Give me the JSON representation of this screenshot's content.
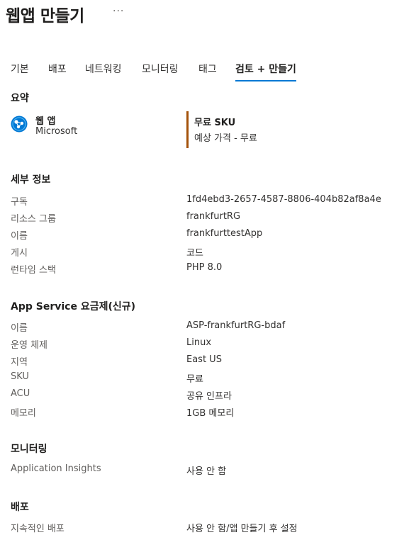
{
  "header": {
    "title": "웹앱 만들기",
    "more": "···"
  },
  "tabs": [
    {
      "label": "기본",
      "active": false
    },
    {
      "label": "배포",
      "active": false
    },
    {
      "label": "네트워킹",
      "active": false
    },
    {
      "label": "모니터링",
      "active": false
    },
    {
      "label": "태그",
      "active": false
    },
    {
      "label": "검토 + 만들기",
      "active": true
    }
  ],
  "summary": {
    "heading": "요약",
    "app_name": "웹 앱",
    "publisher": "Microsoft",
    "sku_title": "무료 SKU",
    "sku_price": "예상 가격 - 무료",
    "accent": "#a4520a"
  },
  "details": {
    "heading": "세부 정보",
    "rows": [
      {
        "key": "구독",
        "value": "1fd4ebd3-2657-4587-8806-404b82af8a4e"
      },
      {
        "key": "리소스 그룹",
        "value": "frankfurtRG"
      },
      {
        "key": "이름",
        "value": "frankfurttestApp"
      },
      {
        "key": "게시",
        "value": "코드"
      },
      {
        "key": "런타임 스택",
        "value": "PHP 8.0"
      }
    ]
  },
  "plan": {
    "heading": "App Service 요금제(신규)",
    "rows": [
      {
        "key": "이름",
        "value": "ASP-frankfurtRG-bdaf"
      },
      {
        "key": "운영 체제",
        "value": "Linux"
      },
      {
        "key": "지역",
        "value": "East US"
      },
      {
        "key": "SKU",
        "value": "무료"
      },
      {
        "key": "ACU",
        "value": "공유 인프라"
      },
      {
        "key": "메모리",
        "value": "1GB 메모리"
      }
    ]
  },
  "monitoring": {
    "heading": "모니터링",
    "rows": [
      {
        "key": "Application Insights",
        "value": "사용 안 함"
      }
    ]
  },
  "deployment": {
    "heading": "배포",
    "rows": [
      {
        "key": "지속적인 배포",
        "value": "사용 안 함/앱 만들기 후 설정"
      }
    ]
  },
  "colors": {
    "tab_underline": "#0078d4",
    "icon_blue": "#0078d4"
  }
}
